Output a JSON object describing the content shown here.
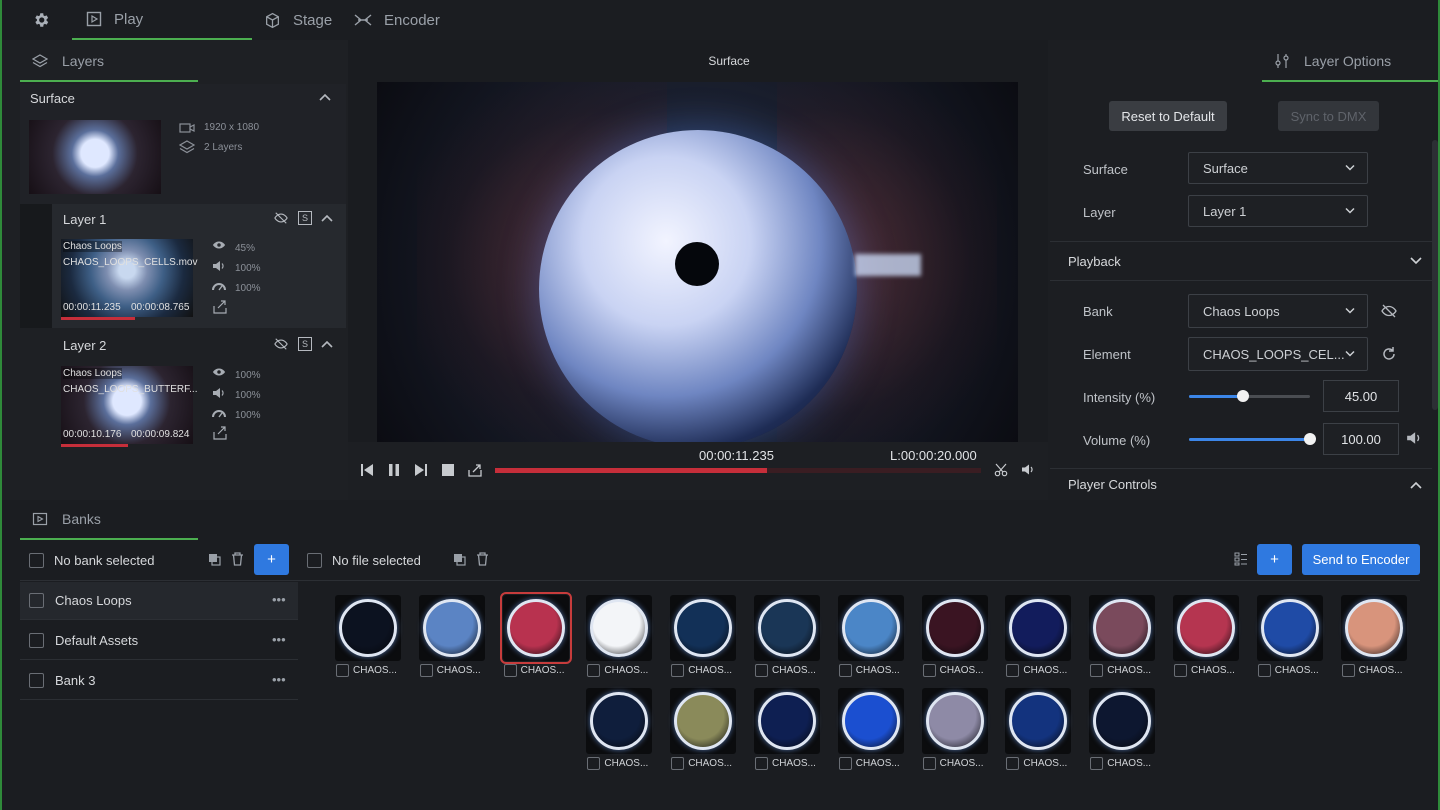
{
  "top_nav": {
    "tabs": [
      {
        "label": "Play",
        "icon": "play-square-icon",
        "active": true
      },
      {
        "label": "Stage",
        "icon": "cube-icon",
        "active": false
      },
      {
        "label": "Encoder",
        "icon": "encoder-icon",
        "active": false
      }
    ]
  },
  "left_panel": {
    "tab_label": "Layers",
    "surface": {
      "title": "Surface",
      "resolution": "1920 x 1080",
      "layers_count": "2 Layers"
    },
    "layers": [
      {
        "title": "Layer 1",
        "bank": "Chaos Loops",
        "file": "CHAOS_LOOPS_CELLS.mov",
        "time_current": "00:00:11.235",
        "time_remaining": "00:00:08.765",
        "intensity": "45%",
        "volume": "100%",
        "speed": "100%",
        "progress": 0.56
      },
      {
        "title": "Layer 2",
        "bank": "Chaos Loops",
        "file": "CHAOS_LOOPS_BUTTERF...",
        "time_current": "00:00:10.176",
        "time_remaining": "00:00:09.824",
        "intensity": "100%",
        "volume": "100%",
        "speed": "100%",
        "progress": 0.51
      }
    ]
  },
  "preview": {
    "title": "Surface",
    "time_current": "00:00:11.235",
    "time_length": "L:00:00:20.000",
    "progress": 0.56
  },
  "right_panel": {
    "tab_label": "Layer Options",
    "reset_button": "Reset to Default",
    "sync_button": "Sync to DMX",
    "surface_label": "Surface",
    "surface_value": "Surface",
    "layer_label": "Layer",
    "layer_value": "Layer 1",
    "playback_header": "Playback",
    "bank_label": "Bank",
    "bank_value": "Chaos Loops",
    "element_label": "Element",
    "element_value": "CHAOS_LOOPS_CEL...",
    "intensity_label": "Intensity (%)",
    "intensity_value": "45.00",
    "intensity_level": 0.45,
    "volume_label": "Volume (%)",
    "volume_value": "100.00",
    "volume_level": 1.0,
    "player_controls_header": "Player Controls"
  },
  "banks": {
    "tab_label": "Banks",
    "no_bank_selected": "No bank selected",
    "no_file_selected": "No file selected",
    "add_label": "+",
    "send_to_encoder": "Send to Encoder",
    "list": [
      "Chaos Loops",
      "Default Assets",
      "Bank 3"
    ],
    "files": [
      {
        "label": "CHAOS...",
        "color": "#0c1220"
      },
      {
        "label": "CHAOS...",
        "color": "#5b84c4"
      },
      {
        "label": "CHAOS...",
        "color": "#b8324f",
        "selected": true
      },
      {
        "label": "CHAOS...",
        "color": "#f3f5f8"
      },
      {
        "label": "CHAOS...",
        "color": "#123057"
      },
      {
        "label": "CHAOS...",
        "color": "#1a3656"
      },
      {
        "label": "CHAOS...",
        "color": "#4b86c7"
      },
      {
        "label": "CHAOS...",
        "color": "#3a1422"
      },
      {
        "label": "CHAOS...",
        "color": "#121c5c"
      },
      {
        "label": "CHAOS...",
        "color": "#7a4a5c"
      },
      {
        "label": "CHAOS...",
        "color": "#b53550"
      },
      {
        "label": "CHAOS...",
        "color": "#1f4ba6"
      },
      {
        "label": "CHAOS...",
        "color": "#d8947c"
      },
      {
        "label": "CHAOS...",
        "color": "#0f1e3c"
      },
      {
        "label": "CHAOS...",
        "color": "#8a8a5a"
      },
      {
        "label": "CHAOS...",
        "color": "#0e1f52"
      },
      {
        "label": "CHAOS...",
        "color": "#1b4fd0"
      },
      {
        "label": "CHAOS...",
        "color": "#8e8aa6"
      },
      {
        "label": "CHAOS...",
        "color": "#13337e"
      },
      {
        "label": "CHAOS...",
        "color": "#0d1730"
      }
    ]
  },
  "colors": {
    "accent_green": "#4caf50",
    "accent_blue": "#2f79e0",
    "progress_red": "#c62e3a"
  }
}
